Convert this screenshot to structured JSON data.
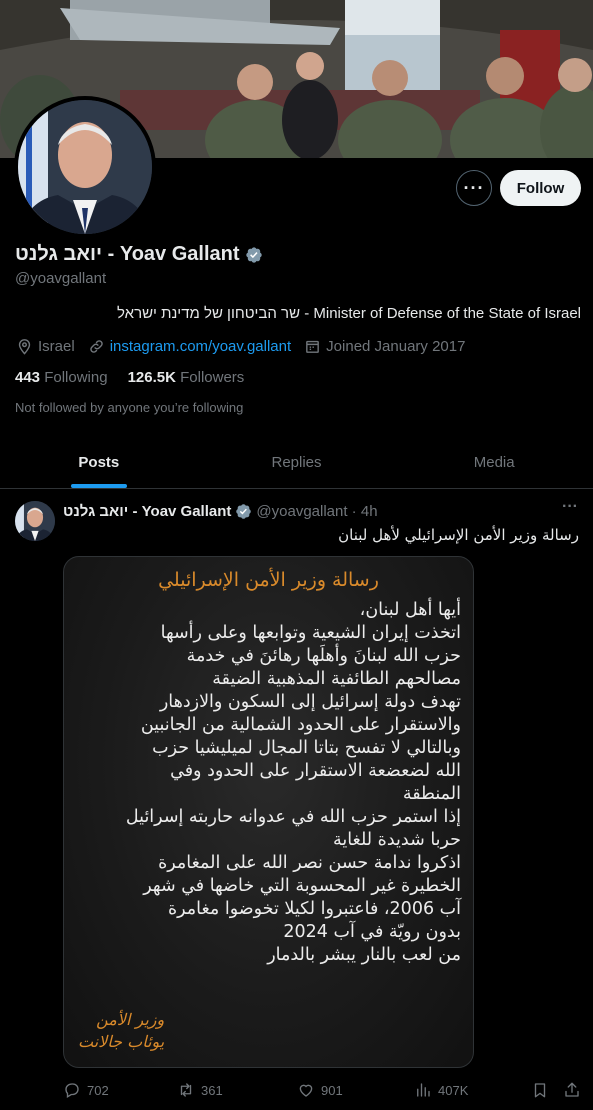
{
  "profile": {
    "display_name": "יואב גלנט - Yoav Gallant",
    "handle": "@yoavgallant",
    "bio": "שר הביטחון של מדינת ישראל - Minister of Defense of the State of Israel",
    "location": "Israel",
    "website": "instagram.com/yoav.gallant",
    "joined": "Joined January 2017",
    "following_count": "443",
    "following_label": "Following",
    "followers_count": "126.5K",
    "followers_label": "Followers",
    "not_followed": "Not followed by anyone you’re following"
  },
  "actions": {
    "more_label": "···",
    "follow_label": "Follow"
  },
  "tabs": [
    {
      "label": "Posts",
      "active": true
    },
    {
      "label": "Replies",
      "active": false
    },
    {
      "label": "Media",
      "active": false
    }
  ],
  "post": {
    "author": "יואב גלנט - Yoav Gallant",
    "handle_time": "@yoavgallant · 4h",
    "more": "···",
    "text": "رسالة وزير الأمن الإسرائيلي لأهل لبنان",
    "image": {
      "title": "رسالة وزير الأمن الإسرائيلي",
      "lines": [
        "أيها أهل لبنان،",
        "اتخذت إيران الشيعية وتوابعها وعلى رأسها",
        "حزب الله لبنانَ وأهلَها رهائنَ في خدمة",
        "مصالحهم الطائفية المذهبية الضيقة",
        "تهدف دولة إسرائيل إلى السكون والازدهار",
        "والاستقرار على الحدود الشمالية من الجانبين",
        "وبالتالي لا تفسح بتاتا المجال لميليشيا حزب",
        "الله لضعضعة الاستقرار على الحدود وفي",
        "المنطقة",
        "إذا استمر حزب الله في عدوانه حاربته إسرائيل",
        "حربا شديدة للغاية",
        "اذكروا ندامة حسن نصر الله على المغامرة",
        "الخطيرة غير المحسوبة التي خاضها في شهر",
        "آب 2006، فاعتبروا لكيلا تخوضوا مغامرة",
        "بدون رويّة في آب 2024",
        "من لعب بالنار يبشر بالدمار"
      ],
      "signature_line1": "وزير الأمن",
      "signature_line2": "يوئاب جالانت"
    },
    "stats": {
      "replies": "702",
      "reposts": "361",
      "likes": "901",
      "views": "407K"
    }
  },
  "colors": {
    "accent": "#1d9bf0",
    "background": "#000000",
    "muted": "#71767b",
    "image_title": "#d98a2b"
  }
}
